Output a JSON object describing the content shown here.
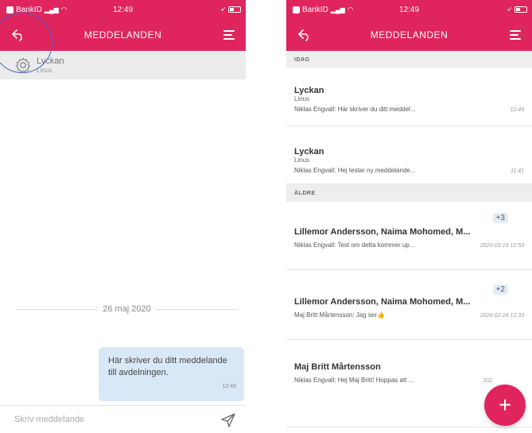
{
  "colors": {
    "accent": "#e0245e",
    "bubble": "#d8e8f7",
    "section_bg": "#eeeeee"
  },
  "status": {
    "carrier": "BankID",
    "time": "12:49"
  },
  "left": {
    "nav_title": "MEDDELANDEN",
    "conversation": {
      "name": "Lyckan",
      "sub": "Linus"
    },
    "date_separator": "26 maj 2020",
    "message": {
      "text": "Här skriver du ditt meddelande till avdelningen.",
      "time": "12:49"
    },
    "input_placeholder": "Skriv meddelande"
  },
  "right": {
    "nav_title": "MEDDELANDEN",
    "section_today": "IDAG",
    "section_older": "ÄLDRE",
    "today": [
      {
        "title": "Lyckan",
        "sub": "Linus",
        "preview": "Niklas Engvall: Här skriver du ditt meddel...",
        "time": "12:49"
      },
      {
        "title": "Lyckan",
        "sub": "Linus",
        "preview": "Niklas Engvall: Hej testar ny meddelande...",
        "time": "11:41"
      }
    ],
    "older": [
      {
        "title": "Lillemor Andersson, Naima Mohomed, M...",
        "badge": "+3",
        "preview": "Niklas Engvall: Test om detta kommer up...",
        "time": "2020-03-19 12:53"
      },
      {
        "title": "Lillemor Andersson, Naima Mohomed, M...",
        "badge": "+2",
        "preview": "Maj Britt Mårtensson: Jag ser👍",
        "time": "2020-02-24 12:33"
      },
      {
        "title": "Maj Britt Mårtensson",
        "preview": "Niklas Engvall: Hej Maj Britt! Hoppas att ...",
        "time": "202"
      }
    ],
    "fab_label": "+"
  },
  "icons": {
    "back": "back-arrow-icon",
    "menu": "hamburger-menu-icon",
    "gear": "gear-icon",
    "send": "send-icon",
    "wifi": "wifi-icon",
    "battery": "battery-icon"
  }
}
